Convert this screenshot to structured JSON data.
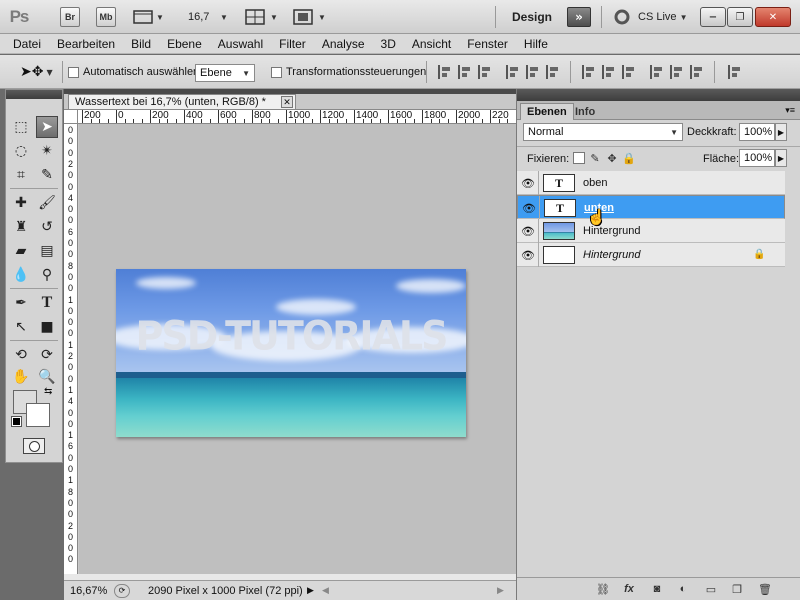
{
  "appbar": {
    "logo": "Ps",
    "bridge": "Br",
    "minibridge": "Mb",
    "zoom": "16,7",
    "workspace": "Design",
    "cs_live": "CS Live",
    "window": {
      "minimize": "−",
      "restore": "❐",
      "close": "✕"
    }
  },
  "menu": [
    "Datei",
    "Bearbeiten",
    "Bild",
    "Ebene",
    "Auswahl",
    "Filter",
    "Analyse",
    "3D",
    "Ansicht",
    "Fenster",
    "Hilfe"
  ],
  "options": {
    "auto_select_label": "Automatisch auswählen:",
    "auto_select_value": "Ebene",
    "transform_label": "Transformationssteuerungen"
  },
  "document": {
    "tab_title": "Wassertext bei 16,7% (unten, RGB/8) *",
    "close": "✕",
    "ruler_h": [
      "200",
      "0",
      "200",
      "400",
      "600",
      "800",
      "1000",
      "1200",
      "1400",
      "1600",
      "1800",
      "2000",
      "220"
    ],
    "ruler_v": [
      "0",
      "0",
      "0",
      "2",
      "0",
      "0",
      "4",
      "0",
      "0",
      "6",
      "0",
      "0",
      "8",
      "0",
      "0",
      "1",
      "0",
      "0",
      "0",
      "1",
      "2",
      "0",
      "0",
      "1",
      "4",
      "0",
      "0",
      "1",
      "6",
      "0",
      "0",
      "1",
      "8",
      "0",
      "0",
      "2",
      "0",
      "0",
      "0"
    ],
    "watermark_text": "PSD-TUTORIALS",
    "status_zoom": "16,67%",
    "status_info": "2090 Pixel x 1000 Pixel (72 ppi)"
  },
  "panel": {
    "tabs": [
      "Ebenen",
      "Info"
    ],
    "blend_mode": "Normal",
    "opacity_label": "Deckkraft:",
    "opacity_value": "100%",
    "lock_label": "Fixieren:",
    "fill_label": "Fläche:",
    "fill_value": "100%",
    "layers": [
      {
        "name": "oben",
        "thumb": "T",
        "selected": false
      },
      {
        "name": "unten",
        "thumb": "T",
        "selected": true
      },
      {
        "name": "Hintergrund",
        "thumb": "",
        "selected": false
      },
      {
        "name": "Hintergrund",
        "thumb": "",
        "selected": false
      }
    ]
  },
  "colors": {
    "selection": "#3e9cf2",
    "sky": "#6e9ae6",
    "sea": "#3bb4c3"
  }
}
